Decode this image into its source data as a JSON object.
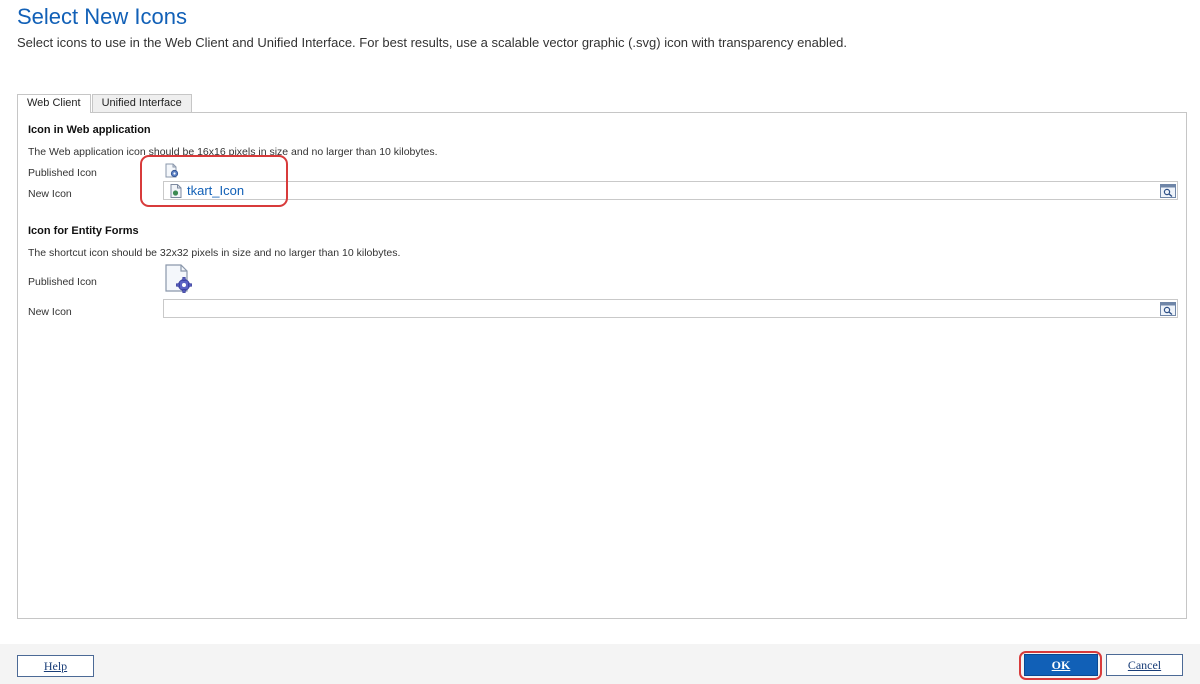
{
  "header": {
    "title": "Select New Icons",
    "subtitle": "Select icons to use in the Web Client and Unified Interface. For best results, use a scalable vector graphic (.svg) icon with transparency enabled."
  },
  "tabs": [
    {
      "label": "Web Client",
      "active": true
    },
    {
      "label": "Unified Interface",
      "active": false
    }
  ],
  "web_app_section": {
    "title": "Icon in Web application",
    "description": "The Web application icon should be 16x16 pixels in size and no larger than 10 kilobytes.",
    "published_label": "Published Icon",
    "new_label": "New Icon",
    "new_icon_value": "tkart_Icon"
  },
  "entity_forms_section": {
    "title": "Icon for Entity Forms",
    "description": "The shortcut icon should be 32x32 pixels in size and no larger than 10 kilobytes.",
    "published_label": "Published Icon",
    "new_label": "New Icon",
    "new_icon_value": ""
  },
  "footer": {
    "help_label": "Help",
    "ok_label": "OK",
    "cancel_label": "Cancel"
  },
  "icons": {
    "published_small": "document-gear-icon",
    "published_large": "document-gear-icon",
    "new_value_icon": "webresource-file-icon",
    "lookup": "lookup-search-icon"
  },
  "colors": {
    "title": "#1160b7",
    "highlight": "#d83b3b",
    "ok_button": "#1160b7"
  }
}
